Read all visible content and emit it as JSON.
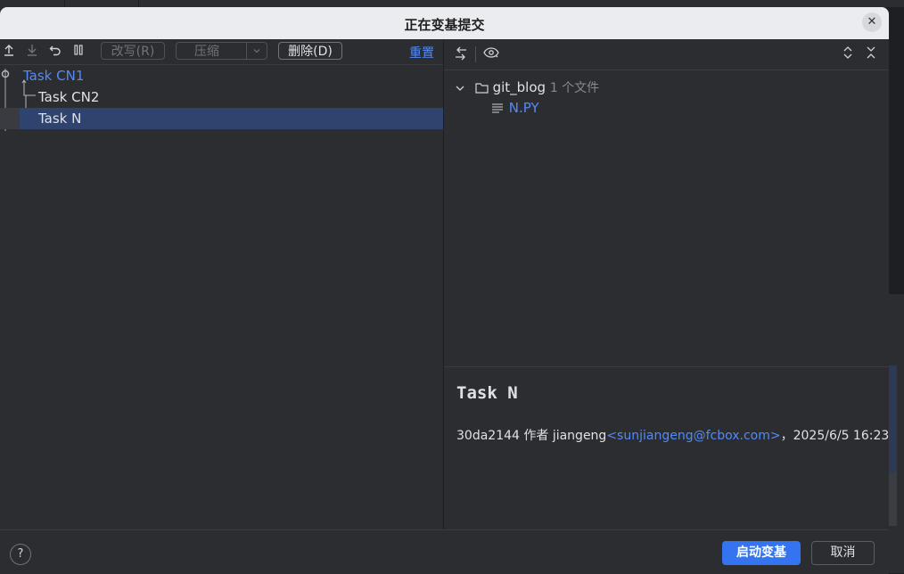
{
  "dialog": {
    "title": "正在变基提交",
    "close_glyph": "✕"
  },
  "toolbar": {
    "icons": [
      "move-up-icon",
      "move-down-icon",
      "undo-icon",
      "pause-icon"
    ],
    "reword_label": "改写(R)",
    "squash_label": "压缩",
    "delete_label": "删除(D)",
    "reset_label": "重置"
  },
  "commits": [
    {
      "label": "Task CN1",
      "selected": false,
      "highlight_color": "#548af7"
    },
    {
      "label": "Task CN2",
      "selected": false
    },
    {
      "label": "Task N",
      "selected": true
    }
  ],
  "changes": {
    "folder": "git_blog",
    "file_count": "1 个文件",
    "file": "N.PY"
  },
  "details": {
    "title": "Task N",
    "hash": "30da2144",
    "author_prefix": "作者",
    "author": "jiangeng",
    "email": "<sunjiangeng@fcbox.com>",
    "date_sep": "，",
    "date": "2025/6/5 16:23"
  },
  "footer": {
    "help_glyph": "?",
    "start_label": "启动变基",
    "cancel_label": "取消"
  },
  "colors": {
    "accent": "#3574f0",
    "link": "#548af7",
    "selection": "#2e436e"
  }
}
